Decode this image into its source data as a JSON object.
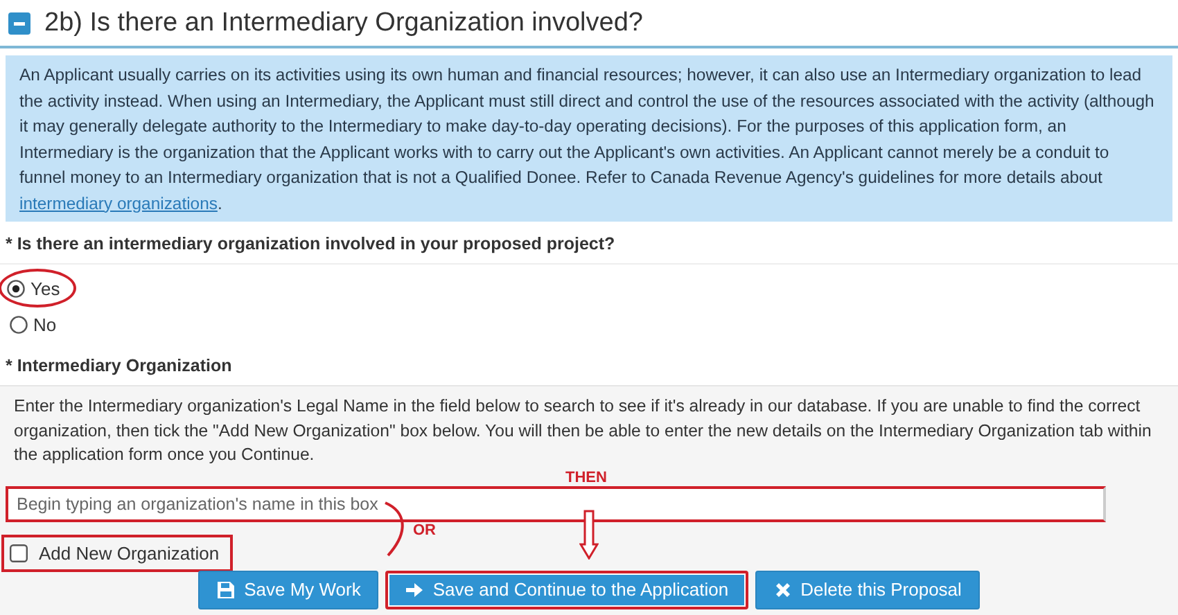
{
  "section": {
    "expanded": true,
    "title": "2b) Is there an Intermediary Organization involved?"
  },
  "info": {
    "text": "An Applicant usually carries on its activities using its own human and financial resources; however, it can also use an Intermediary organization to lead the activity instead. When using an Intermediary, the Applicant must still direct and control the use of the resources associated with the activity (although it may generally delegate authority to the Intermediary to make day-to-day operating decisions). For the purposes of this application form, an Intermediary is the organization that the Applicant works with to carry out the Applicant's own activities. An Applicant cannot merely be a conduit to funnel money to an Intermediary organization that is not a Qualified Donee. Refer to Canada Revenue Agency's guidelines for more details about ",
    "link": "intermediary organizations",
    "after": "."
  },
  "question": {
    "label": "* Is there an intermediary organization involved in your proposed project?",
    "options": [
      {
        "label": "Yes",
        "selected": true,
        "circled": true
      },
      {
        "label": "No",
        "selected": false,
        "circled": false
      }
    ]
  },
  "organization": {
    "label": "* Intermediary Organization",
    "help": "Enter the Intermediary organization's Legal Name in the field below to search to see if it's already in our database. If you are unable to find the correct organization, then tick the \"Add New Organization\" box below. You will then be able to enter the new details on the Intermediary Organization tab within the application form once you Continue.",
    "search": {
      "placeholder": "Begin typing an organization's name in this box",
      "highlighted": true
    },
    "add_new": {
      "label": "Add New Organization",
      "checked": false,
      "highlighted": true
    }
  },
  "annotations": {
    "or": "OR",
    "then": "THEN"
  },
  "buttons": [
    {
      "kind": "save",
      "label": "Save My Work",
      "highlighted": false
    },
    {
      "kind": "arrow",
      "label": "Save and Continue to the Application",
      "highlighted": true
    },
    {
      "kind": "close",
      "label": "Delete this Proposal",
      "highlighted": false
    }
  ]
}
